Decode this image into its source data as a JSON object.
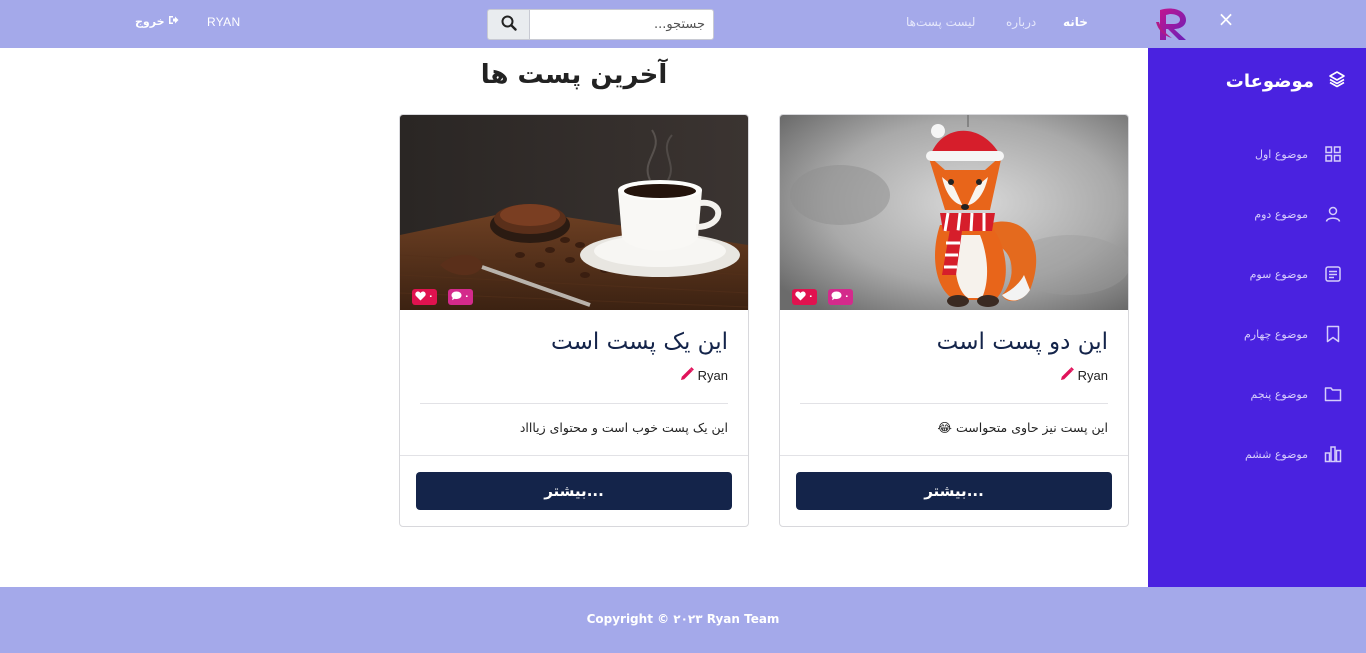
{
  "navbar": {
    "close_icon": "×",
    "links": {
      "home": "خانه",
      "about": "درباره",
      "posts": "لیست پست‌ها"
    },
    "search": {
      "placeholder": "جستجو..."
    },
    "user": "RYAN",
    "logout": "خروج",
    "colors": {
      "bg": "#a4a9ea"
    }
  },
  "sidebar": {
    "title": "موضوعات",
    "items": [
      {
        "label": "موضوع اول",
        "icon": "grid-icon"
      },
      {
        "label": "موضوع دوم",
        "icon": "user-icon"
      },
      {
        "label": "موضوع سوم",
        "icon": "document-icon"
      },
      {
        "label": "موضوع چهارم",
        "icon": "bookmark-icon"
      },
      {
        "label": "موضوع پنجم",
        "icon": "folder-icon"
      },
      {
        "label": "موضوع ششم",
        "icon": "bar-chart-icon"
      }
    ],
    "colors": {
      "bg": "#4a22e0"
    }
  },
  "main": {
    "title": "آخرین پست ها",
    "posts": [
      {
        "title": "این دو پست است",
        "author": "Ryan",
        "excerpt": "این پست نیز حاوی متحواست",
        "emoji": "😂",
        "likes": "۰",
        "comments": "۰",
        "button": "بیشتر...",
        "image": "fox-ornament"
      },
      {
        "title": "این یک پست است",
        "author": "Ryan",
        "excerpt": "این یک پست خوب است و محتوای زیاااد",
        "emoji": "",
        "likes": "۰",
        "comments": "۰",
        "button": "بیشتر...",
        "image": "coffee-cup"
      }
    ]
  },
  "footer": {
    "text": "Copyright © ۲۰۲۳ Ryan Team"
  }
}
